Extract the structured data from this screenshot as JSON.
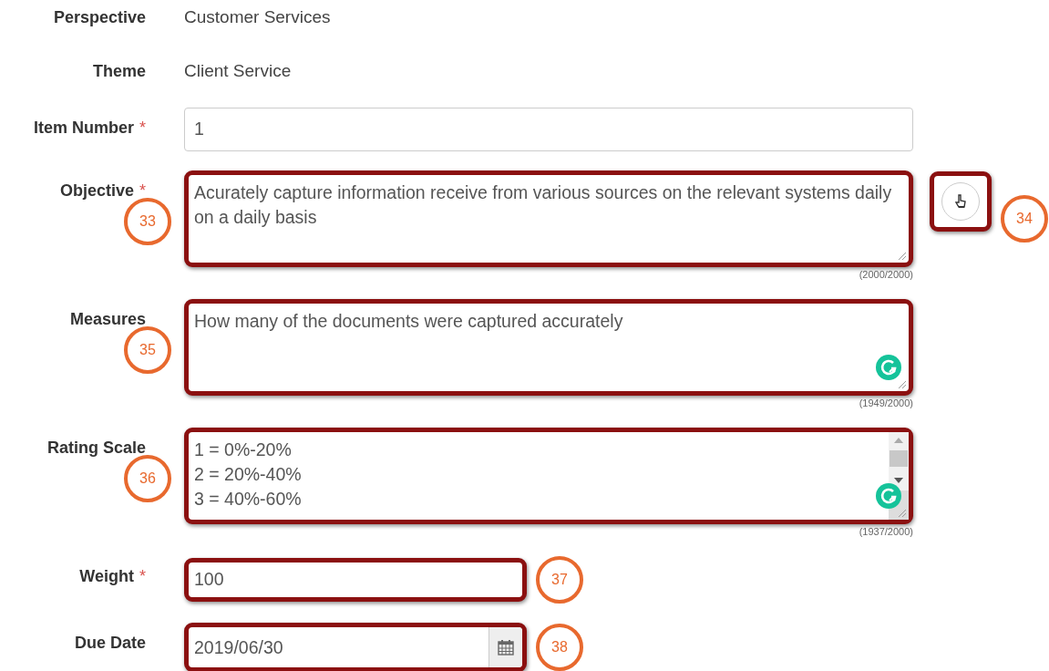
{
  "fields": [
    {
      "kind": "static",
      "label": "Perspective",
      "value": "Customer Services"
    },
    {
      "kind": "static",
      "label": "Theme",
      "value": "Client Service"
    },
    {
      "kind": "input",
      "label": "Item Number",
      "required_mark": "*",
      "value": "1",
      "highlighted": false
    },
    {
      "kind": "textarea",
      "label": "Objective",
      "required_mark": "*",
      "value": "Acurately capture information receive from various sources on the relevant systems daily on a daily basis",
      "counter": "(2000/2000)",
      "highlighted": true,
      "grammar_badge": false,
      "callout": {
        "number": "33"
      },
      "side_button": {
        "highlighted": true,
        "callout": {
          "number": "34"
        }
      }
    },
    {
      "kind": "textarea",
      "label": "Measures",
      "value": "How many of the documents were captured accurately",
      "counter": "(1949/2000)",
      "highlighted": true,
      "grammar_badge": true,
      "callout": {
        "number": "35"
      }
    },
    {
      "kind": "textarea",
      "label": "Rating Scale",
      "value": "1 = 0%-20%\n2 = 20%-40%\n3 = 40%-60%",
      "counter": "(1937/2000)",
      "highlighted": true,
      "grammar_badge": true,
      "scrollbar": true,
      "callout": {
        "number": "36"
      }
    },
    {
      "kind": "input",
      "label": "Weight",
      "required_mark": "*",
      "value": "100",
      "highlighted": true,
      "callout": {
        "number": "37"
      }
    },
    {
      "kind": "date",
      "label": "Due Date",
      "value": "2019/06/30",
      "highlighted": true,
      "callout": {
        "number": "38"
      }
    }
  ]
}
